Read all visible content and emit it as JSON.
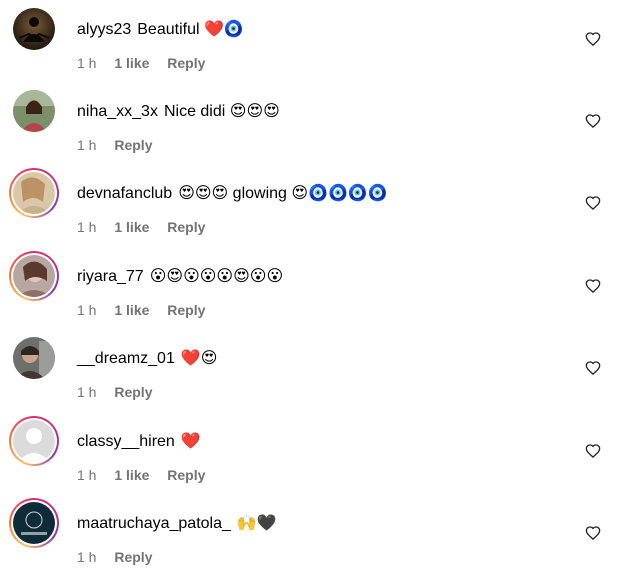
{
  "comments": [
    {
      "username": "alyys23",
      "text": "Beautiful ❤️🧿",
      "time": "1 h",
      "likes": "1 like",
      "reply": "Reply",
      "story_ring": false
    },
    {
      "username": "niha_xx_3x",
      "text": "Nice didi 😍😍😍",
      "time": "1 h",
      "likes": "",
      "reply": "Reply",
      "story_ring": false
    },
    {
      "username": "devnafanclub",
      "text": "😍😍😍 glowing 😍🧿🧿🧿🧿",
      "time": "1 h",
      "likes": "1 like",
      "reply": "Reply",
      "story_ring": true
    },
    {
      "username": "riyara_77",
      "text": "😮😍😮😮😮😍😮😮",
      "time": "1 h",
      "likes": "1 like",
      "reply": "Reply",
      "story_ring": true
    },
    {
      "username": "__dreamz_01",
      "text": "❤️😍",
      "time": "1 h",
      "likes": "",
      "reply": "Reply",
      "story_ring": false
    },
    {
      "username": "classy__hiren",
      "text": "❤️",
      "time": "1 h",
      "likes": "1 like",
      "reply": "Reply",
      "story_ring": true
    },
    {
      "username": "maatruchaya_patola_",
      "text": "🙌🖤",
      "time": "1 h",
      "likes": "",
      "reply": "Reply",
      "story_ring": true
    }
  ],
  "icons": {
    "like": "heart-outline-icon"
  },
  "colors": {
    "meta_text": "#737373",
    "story_ring_start": "#fdc468",
    "story_ring_end": "#833ab4"
  }
}
